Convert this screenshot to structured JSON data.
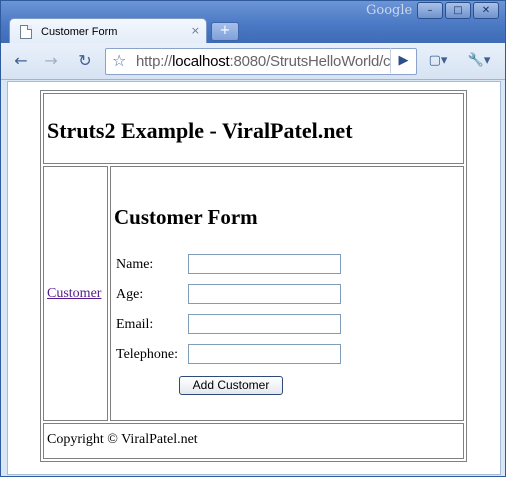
{
  "browser": {
    "brand": "Google",
    "window_buttons": {
      "minimize": "–",
      "maximize": "□",
      "close": "✕"
    },
    "tab": {
      "title": "Customer Form",
      "close": "×"
    },
    "new_tab": "+",
    "toolbar": {
      "back_icon": "←",
      "forward_icon": "→",
      "reload_icon": "↻",
      "star_icon": "☆",
      "go_icon": "▶",
      "page_menu_icon": "▢▾",
      "wrench_menu_icon": "🔧▾",
      "url_prefix": "http://",
      "url_host": "localhost",
      "url_rest": ":8080/StrutsHelloWorld/c"
    }
  },
  "page": {
    "heading": "Struts2 Example - ViralPatel.net",
    "menu_link": "Customer",
    "form": {
      "title": "Customer Form",
      "fields": [
        {
          "label": "Name:",
          "value": ""
        },
        {
          "label": "Age:",
          "value": ""
        },
        {
          "label": "Email:",
          "value": ""
        },
        {
          "label": "Telephone:",
          "value": ""
        }
      ],
      "submit_label": "Add Customer"
    },
    "footer": "Copyright © ViralPatel.net"
  },
  "colors": {
    "titlebar": "#4b79c4",
    "visited_link": "#551a8b",
    "table_border": "#808080"
  }
}
